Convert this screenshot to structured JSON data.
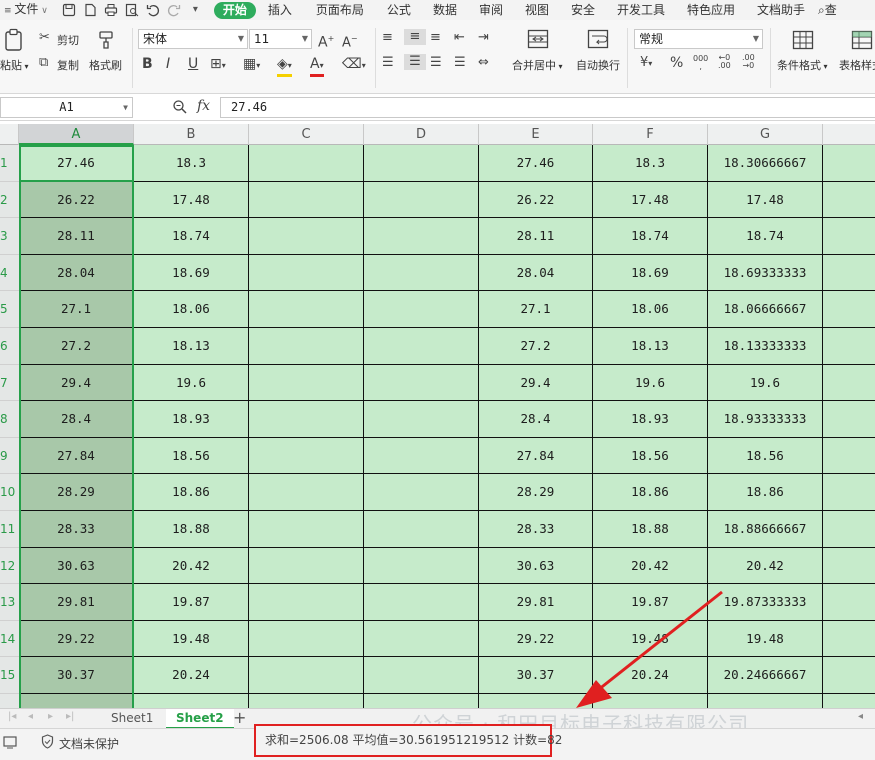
{
  "menubar": {
    "file": "文件",
    "items": [
      "开始",
      "插入",
      "页面布局",
      "公式",
      "数据",
      "审阅",
      "视图",
      "安全",
      "开发工具",
      "特色应用",
      "文档助手"
    ],
    "search": "查"
  },
  "ribbon": {
    "paste": "粘贴",
    "cut": "剪切",
    "copy": "复制",
    "format_painter": "格式刷",
    "font_name": "宋体",
    "font_size": "11",
    "merge_center": "合并居中",
    "wrap_text": "自动换行",
    "number_format": "常规",
    "conditional_format": "条件格式",
    "table_style": "表格样式"
  },
  "formula_bar": {
    "name_box": "A1",
    "fx": "fx",
    "value": "27.46"
  },
  "columns": [
    "A",
    "B",
    "C",
    "D",
    "E",
    "F",
    "G"
  ],
  "rows": [
    {
      "num": "1",
      "a": "27.46",
      "b": "18.3",
      "e": "27.46",
      "f": "18.3",
      "g": "18.30666667"
    },
    {
      "num": "2",
      "a": "26.22",
      "b": "17.48",
      "e": "26.22",
      "f": "17.48",
      "g": "17.48"
    },
    {
      "num": "3",
      "a": "28.11",
      "b": "18.74",
      "e": "28.11",
      "f": "18.74",
      "g": "18.74"
    },
    {
      "num": "4",
      "a": "28.04",
      "b": "18.69",
      "e": "28.04",
      "f": "18.69",
      "g": "18.69333333"
    },
    {
      "num": "5",
      "a": "27.1",
      "b": "18.06",
      "e": "27.1",
      "f": "18.06",
      "g": "18.06666667"
    },
    {
      "num": "6",
      "a": "27.2",
      "b": "18.13",
      "e": "27.2",
      "f": "18.13",
      "g": "18.13333333"
    },
    {
      "num": "7",
      "a": "29.4",
      "b": "19.6",
      "e": "29.4",
      "f": "19.6",
      "g": "19.6"
    },
    {
      "num": "8",
      "a": "28.4",
      "b": "18.93",
      "e": "28.4",
      "f": "18.93",
      "g": "18.93333333"
    },
    {
      "num": "9",
      "a": "27.84",
      "b": "18.56",
      "e": "27.84",
      "f": "18.56",
      "g": "18.56"
    },
    {
      "num": "10",
      "a": "28.29",
      "b": "18.86",
      "e": "28.29",
      "f": "18.86",
      "g": "18.86"
    },
    {
      "num": "11",
      "a": "28.33",
      "b": "18.88",
      "e": "28.33",
      "f": "18.88",
      "g": "18.88666667"
    },
    {
      "num": "12",
      "a": "30.63",
      "b": "20.42",
      "e": "30.63",
      "f": "20.42",
      "g": "20.42"
    },
    {
      "num": "13",
      "a": "29.81",
      "b": "19.87",
      "e": "29.81",
      "f": "19.87",
      "g": "19.87333333"
    },
    {
      "num": "14",
      "a": "29.22",
      "b": "19.48",
      "e": "29.22",
      "f": "19.48",
      "g": "19.48"
    },
    {
      "num": "15",
      "a": "30.37",
      "b": "20.24",
      "e": "30.37",
      "f": "20.24",
      "g": "20.24666667"
    }
  ],
  "sheets": [
    "Sheet1",
    "Sheet2"
  ],
  "active_sheet": "Sheet2",
  "status": {
    "protect": "文档未保护",
    "summary": "求和=2506.08   平均值=30.561951219512   计数=82"
  },
  "watermark": "公众号 · 和田目标电子科技有限公司",
  "colors": {
    "accent": "#2eac5d",
    "cell_bg": "#c6ebcb",
    "selected_col": "#a8c8a9",
    "highlight": "#e02020"
  }
}
